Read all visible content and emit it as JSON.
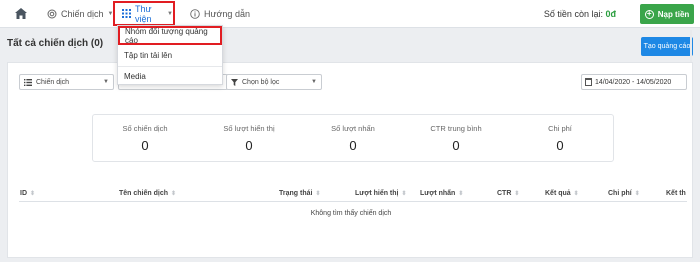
{
  "nav": {
    "campaigns_label": "Chiến dịch",
    "library_label": "Thư viện",
    "guide_label": "Hướng dẫn",
    "balance_label": "Số tiền còn lại:",
    "balance_value": "0đ",
    "topup_label": "Nạp tiền"
  },
  "dropdown": {
    "items": [
      {
        "label": "Nhóm đối tượng quảng cáo"
      },
      {
        "label": "Tập tin tải lên"
      },
      {
        "label": "Media"
      }
    ]
  },
  "page": {
    "title": "Tất cả chiến dịch (0)",
    "create_button": "Tạo quảng cáo"
  },
  "filters": {
    "campaign_select": "Chiến dịch",
    "filter_select": "Chọn bộ lọc",
    "date_range": "14/04/2020 - 14/05/2020"
  },
  "stats": [
    {
      "label": "Số chiến dịch",
      "value": "0"
    },
    {
      "label": "Số lượt hiển thị",
      "value": "0"
    },
    {
      "label": "Số lượt nhấn",
      "value": "0"
    },
    {
      "label": "CTR trung bình",
      "value": "0"
    },
    {
      "label": "Chi phí",
      "value": "0"
    }
  ],
  "table": {
    "columns": [
      "ID",
      "Tên chiến dịch",
      "Trạng thái",
      "Lượt hiển thị",
      "Lượt nhấn",
      "CTR",
      "Kết quả",
      "Chi phí",
      "Kết th"
    ],
    "empty_message": "Không tìm thấy chiến dịch"
  },
  "colors": {
    "accent_blue": "#1e88e5",
    "active_nav": "#1d6fd8",
    "topup_green": "#3aa54a",
    "highlight_red": "#e11d22"
  }
}
